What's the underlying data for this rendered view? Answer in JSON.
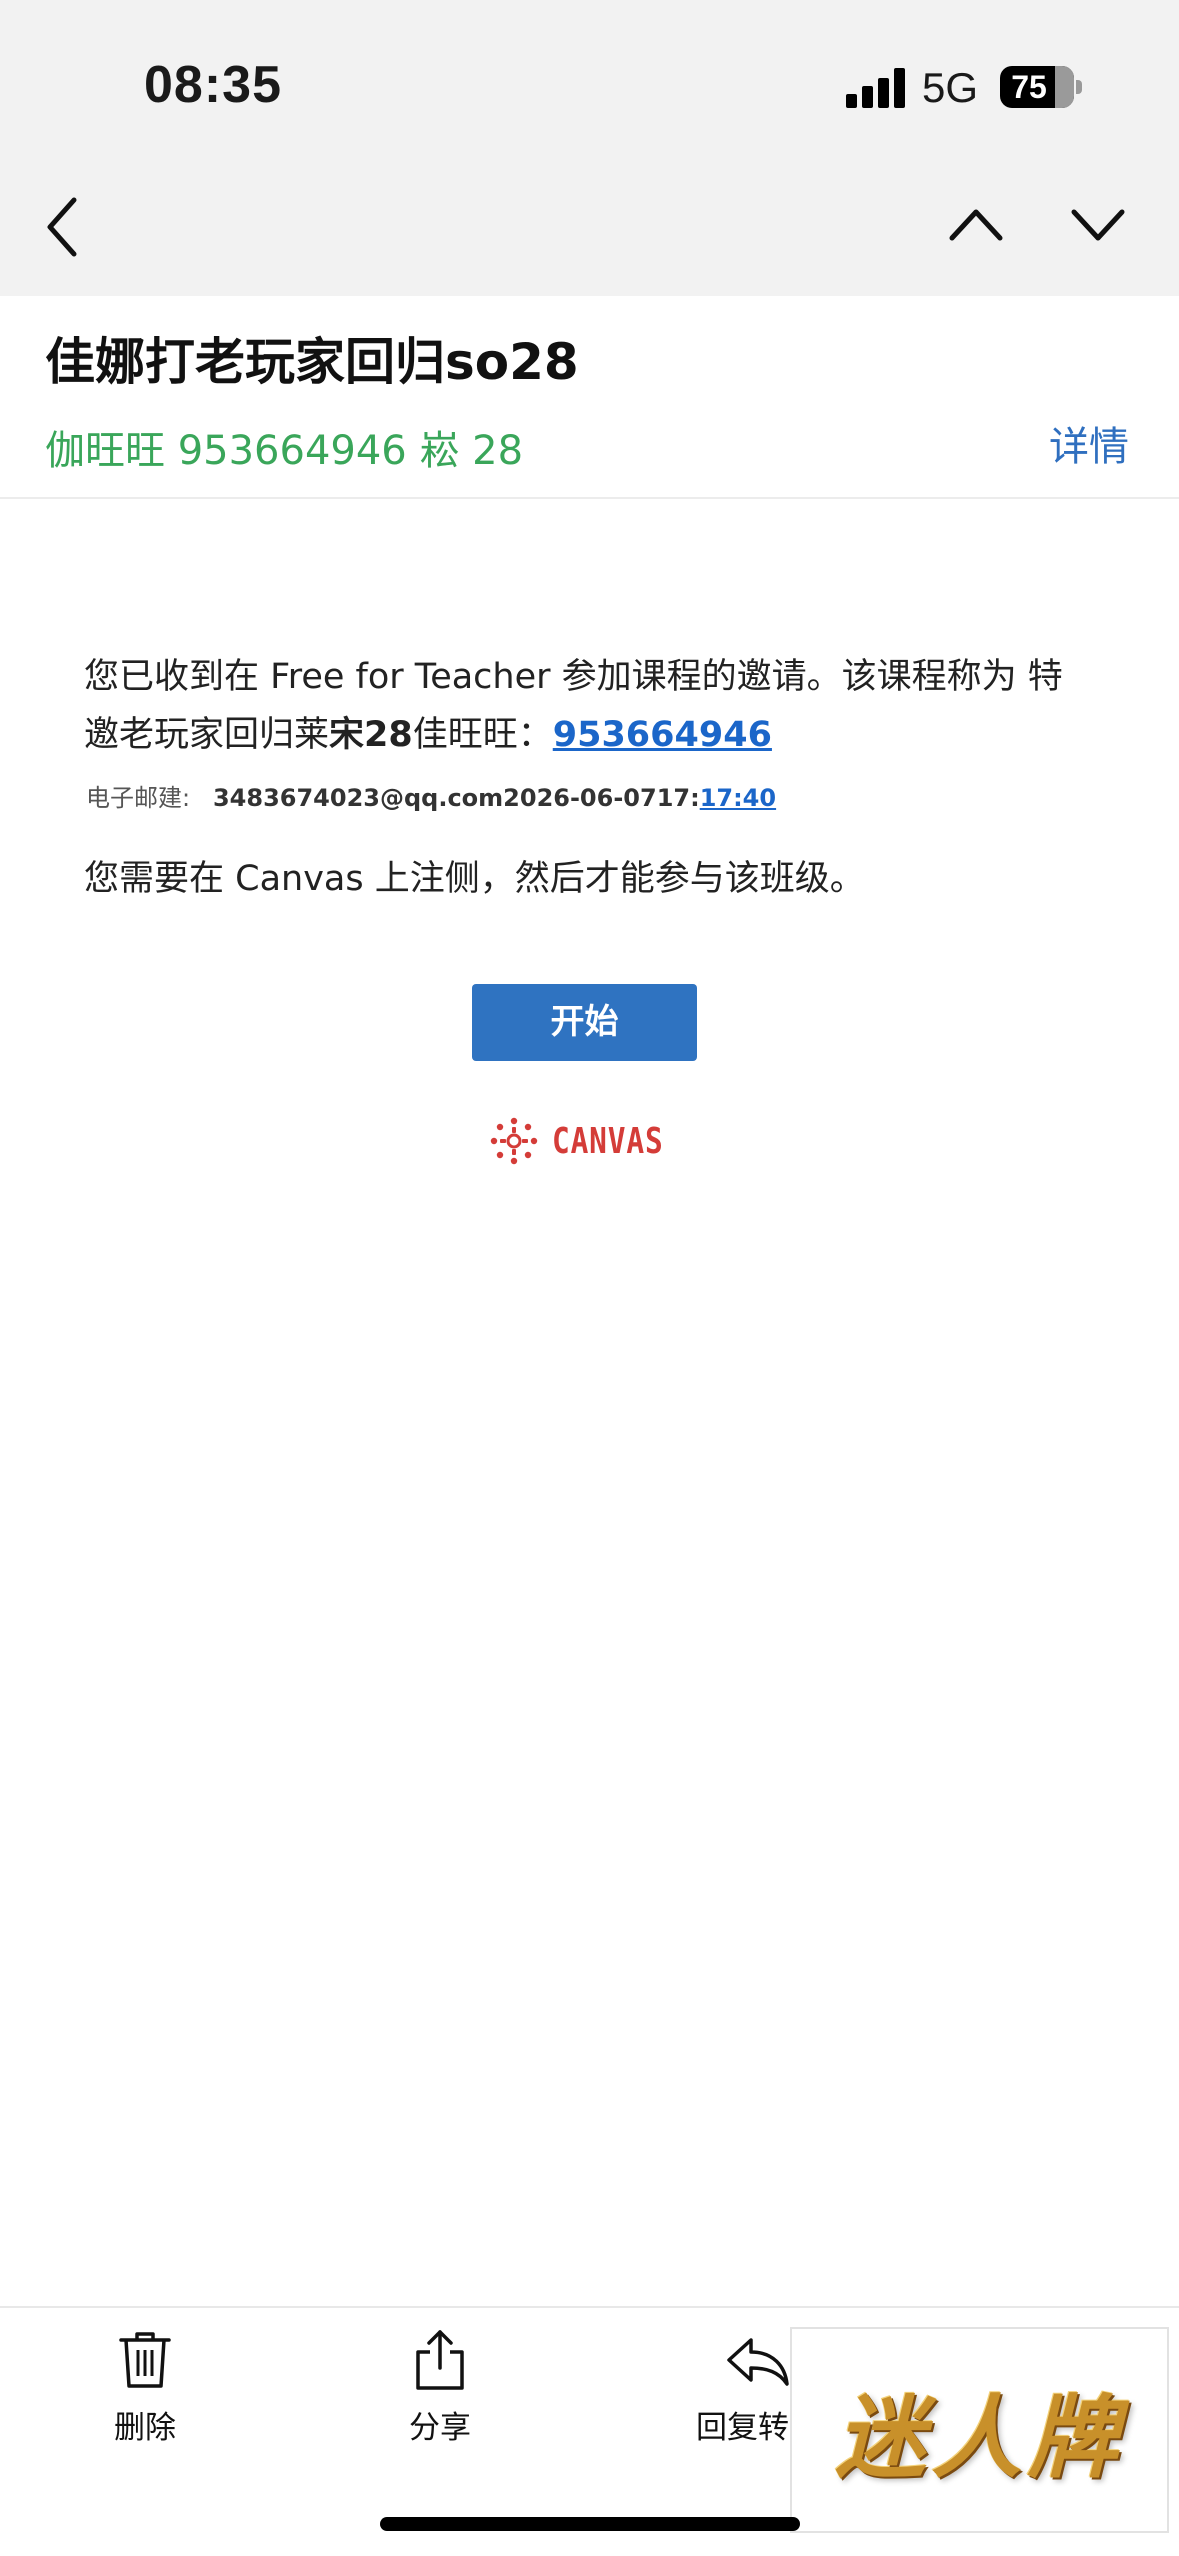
{
  "status_bar": {
    "time": "08:35",
    "network": "5G",
    "battery": "75",
    "battery_level": 0.75
  },
  "nav": {
    "back_icon": "chevron-left-icon",
    "prev_icon": "chevron-up-icon",
    "next_icon": "chevron-down-icon"
  },
  "email": {
    "subject": "佳娜打老玩家回归so28",
    "sender": "伽旺旺 953664946 崧 28",
    "details_label": "详情"
  },
  "body": {
    "para1_part1": "您已收到在 Free for Teacher 参加课程的邀请。该课程称为 特邀老玩家回归莱",
    "para1_bold": "宋28",
    "para1_part2": "佳旺旺：",
    "para1_link": "953664946",
    "email_label": "电子邮建:",
    "email_value": "3483674023@qq.com2026-06-0717:",
    "email_time_link": "17:40",
    "para2": "您需要在 Canvas 上注侧，然后才能参与该班级。",
    "start_button": "开始",
    "logo_text": "CANVAS"
  },
  "toolbar": {
    "delete_label": "删除",
    "share_label": "分享",
    "reply_label": "回复转发"
  },
  "watermark": {
    "text": "迷人牌"
  },
  "colors": {
    "sender_green": "#3aa65a",
    "link_blue": "#1b66c9",
    "button_blue": "#2f73c1",
    "canvas_red": "#d43c38"
  }
}
